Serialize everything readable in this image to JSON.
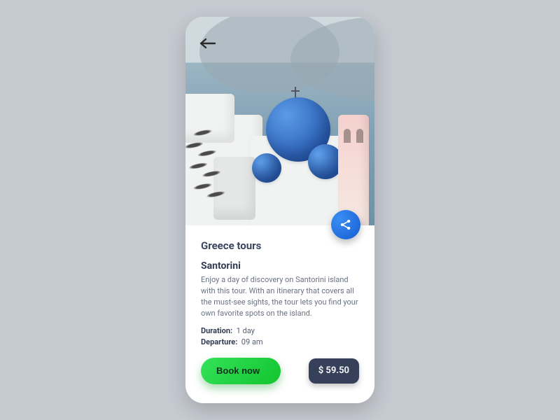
{
  "tour": {
    "category": "Greece tours",
    "title": "Santorini",
    "description": "Enjoy a day of discovery on Santorini island with this tour. With an itinerary that covers all the must-see sights, the tour lets you find your own favorite spots on the island.",
    "duration_label": "Duration:",
    "duration_value": "1 day",
    "departure_label": "Departure:",
    "departure_value": "09 am",
    "book_label": "Book now",
    "price": "$ 59.50"
  },
  "icons": {
    "back": "back-arrow-icon",
    "share": "share-icon"
  }
}
